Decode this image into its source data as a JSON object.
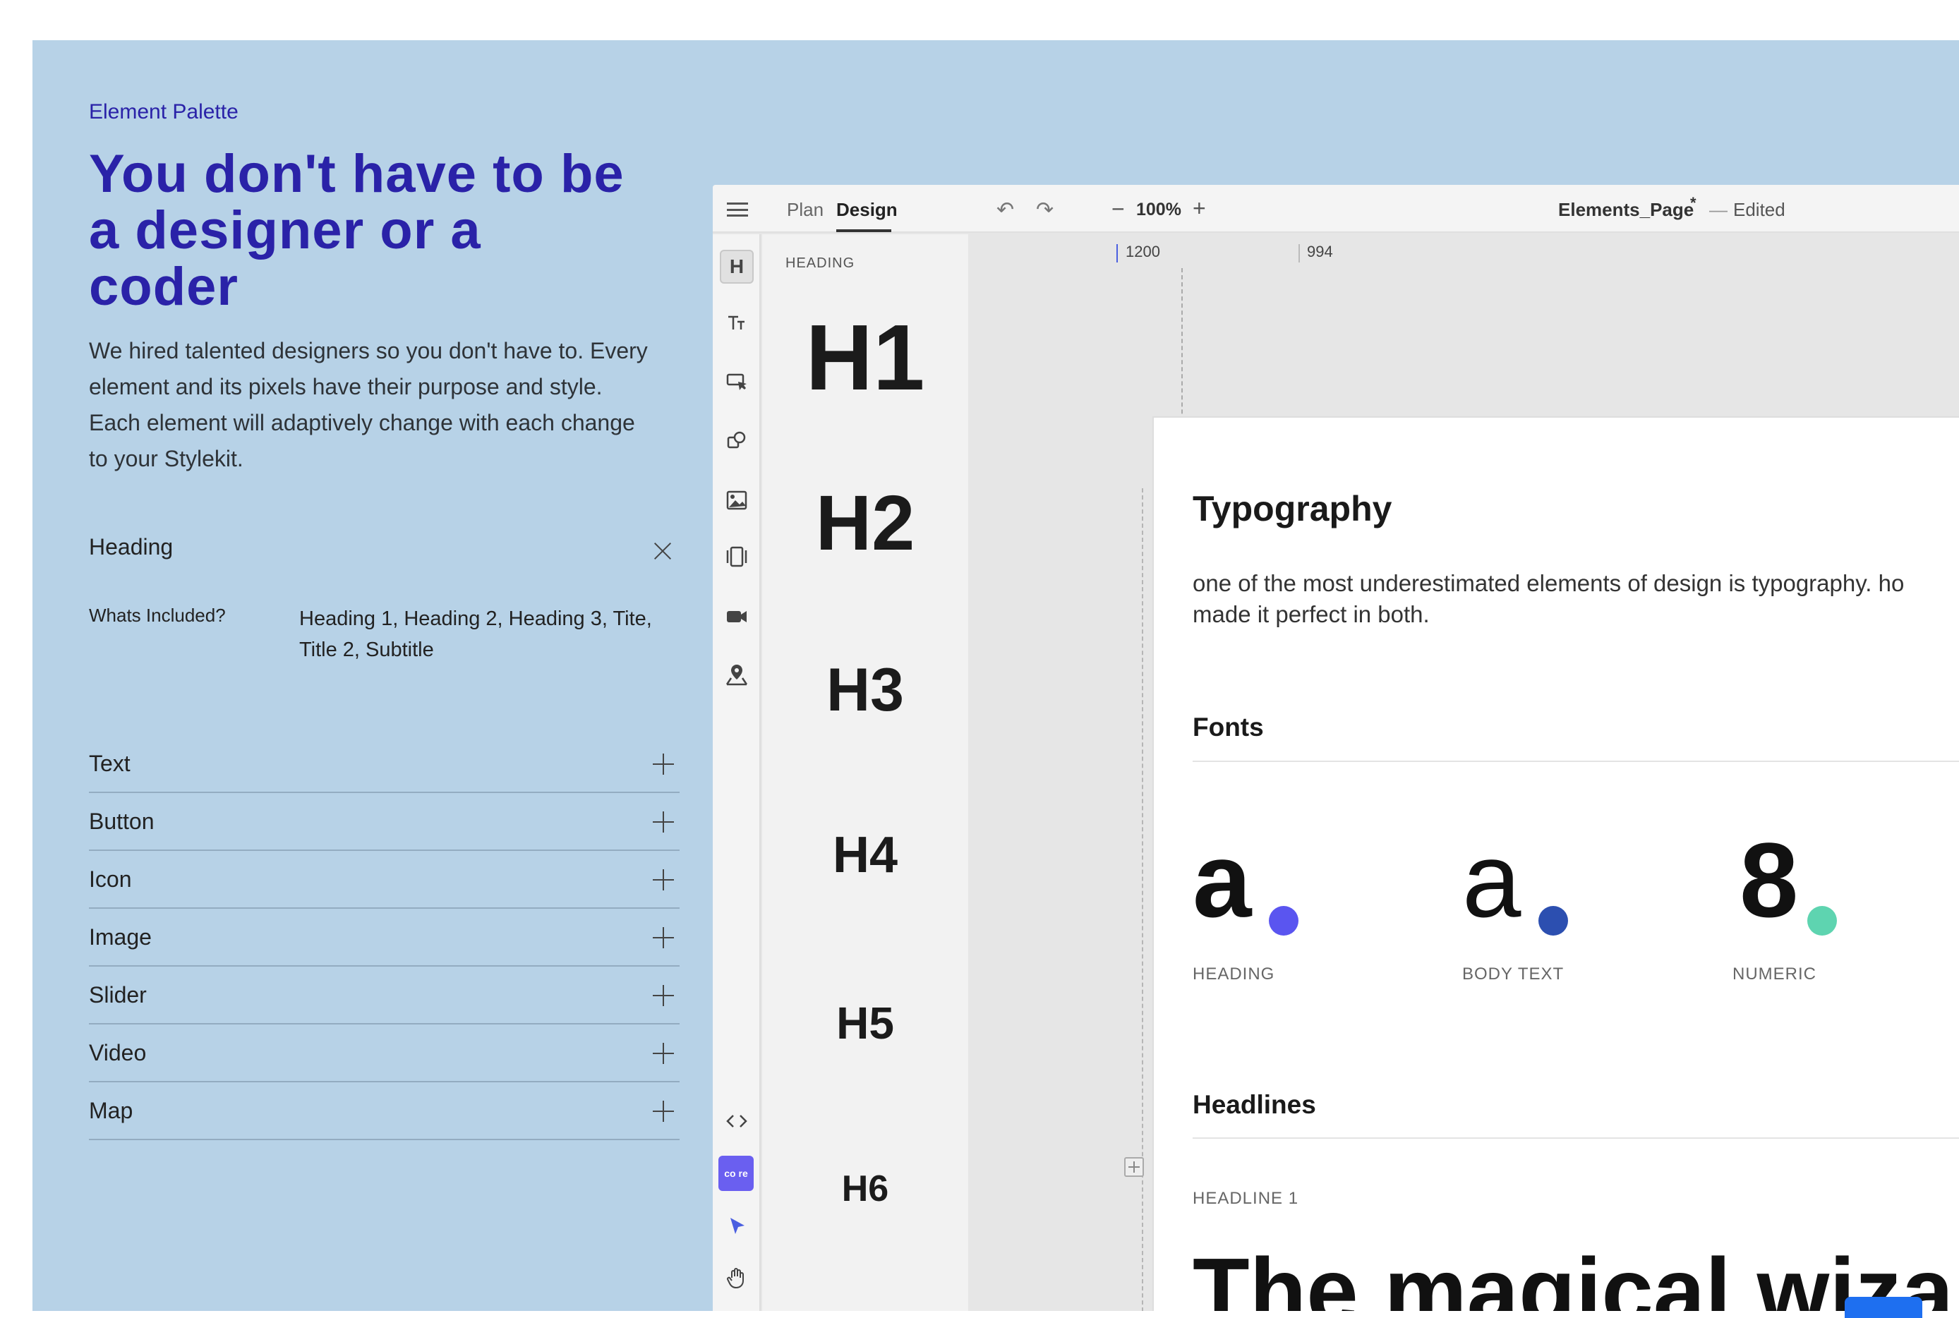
{
  "hero": {
    "eyebrow": "Element Palette",
    "title": "You don't have to be a designer or a coder",
    "body": "We hired talented designers so you don't have to. Every element and its pixels have their purpose and style. Each element will adaptively change with each change to your Stylekit."
  },
  "accordion": {
    "open_item": {
      "title": "Heading",
      "whats_included_label": "Whats Included?",
      "whats_included_value": "Heading 1, Heading 2, Heading 3, Tite, Title 2, Subtitle"
    },
    "items": [
      {
        "label": "Text"
      },
      {
        "label": "Button"
      },
      {
        "label": "Icon"
      },
      {
        "label": "Image"
      },
      {
        "label": "Slider"
      },
      {
        "label": "Video"
      },
      {
        "label": "Map"
      }
    ]
  },
  "app": {
    "tabs": {
      "plan": "Plan",
      "design": "Design"
    },
    "zoom": {
      "minus": "−",
      "value": "100%",
      "plus": "+"
    },
    "document": {
      "name": "Elements_Page",
      "modified_mark": "*",
      "separator": "—",
      "status": "Edited"
    },
    "toolbar": {
      "heading_tool": "H",
      "core_badge": "co re"
    },
    "element_panel": {
      "title": "HEADING",
      "items": [
        "H1",
        "H2",
        "H3",
        "H4",
        "H5",
        "H6"
      ]
    },
    "ruler": {
      "width_label": "1200",
      "height_label": "994"
    },
    "canvas": {
      "title": "Typography",
      "description": "one of the most underestimated elements of design is typography. ho\nmade it perfect in both.",
      "fonts_heading": "Fonts",
      "fonts": [
        {
          "glyph": "a",
          "label": "HEADING",
          "dot_color": "#5a55f0"
        },
        {
          "glyph": "a",
          "label": "BODY TEXT",
          "dot_color": "#2c4fb0"
        },
        {
          "glyph": "8",
          "label": "NUMERIC",
          "dot_color": "#5ed4b0"
        }
      ],
      "headlines_heading": "Headlines",
      "headline1_label": "HEADLINE 1",
      "headline1_sample": "The magical wiza"
    }
  },
  "colors": {
    "panel_bg": "#b7d2e7",
    "accent": "#2a22a8",
    "tool_active": "#6a5ff0"
  }
}
